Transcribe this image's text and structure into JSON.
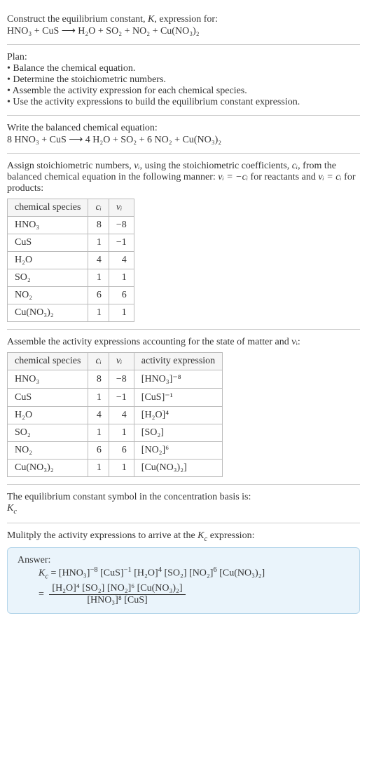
{
  "intro": {
    "line1": "Construct the equilibrium constant, ",
    "K": "K",
    "line1b": ", expression for:",
    "eq": "HNO₃ + CuS ⟶ H₂O + SO₂ + NO₂ + Cu(NO₃)₂"
  },
  "plan": {
    "header": "Plan:",
    "b1": "• Balance the chemical equation.",
    "b2": "• Determine the stoichiometric numbers.",
    "b3": "• Assemble the activity expression for each chemical species.",
    "b4": "• Use the activity expressions to build the equilibrium constant expression."
  },
  "balanced": {
    "header": "Write the balanced chemical equation:",
    "eq": "8 HNO₃ + CuS ⟶ 4 H₂O + SO₂ + 6 NO₂ + Cu(NO₃)₂"
  },
  "stoich": {
    "text1": "Assign stoichiometric numbers, ",
    "nu": "νᵢ",
    "text2": ", using the stoichiometric coefficients, ",
    "ci": "cᵢ",
    "text3": ", from the balanced chemical equation in the following manner: ",
    "rule1": "νᵢ = −cᵢ",
    "text4": " for reactants and ",
    "rule2": "νᵢ = cᵢ",
    "text5": " for products:",
    "headers": {
      "h1": "chemical species",
      "h2": "cᵢ",
      "h3": "νᵢ"
    },
    "rows": [
      {
        "sp": "HNO₃",
        "c": "8",
        "v": "−8"
      },
      {
        "sp": "CuS",
        "c": "1",
        "v": "−1"
      },
      {
        "sp": "H₂O",
        "c": "4",
        "v": "4"
      },
      {
        "sp": "SO₂",
        "c": "1",
        "v": "1"
      },
      {
        "sp": "NO₂",
        "c": "6",
        "v": "6"
      },
      {
        "sp": "Cu(NO₃)₂",
        "c": "1",
        "v": "1"
      }
    ]
  },
  "activity": {
    "text": "Assemble the activity expressions accounting for the state of matter and νᵢ:",
    "headers": {
      "h1": "chemical species",
      "h2": "cᵢ",
      "h3": "νᵢ",
      "h4": "activity expression"
    },
    "rows": [
      {
        "sp": "HNO₃",
        "c": "8",
        "v": "−8",
        "a": "[HNO₃]⁻⁸"
      },
      {
        "sp": "CuS",
        "c": "1",
        "v": "−1",
        "a": "[CuS]⁻¹"
      },
      {
        "sp": "H₂O",
        "c": "4",
        "v": "4",
        "a": "[H₂O]⁴"
      },
      {
        "sp": "SO₂",
        "c": "1",
        "v": "1",
        "a": "[SO₂]"
      },
      {
        "sp": "NO₂",
        "c": "6",
        "v": "6",
        "a": "[NO₂]⁶"
      },
      {
        "sp": "Cu(NO₃)₂",
        "c": "1",
        "v": "1",
        "a": "[Cu(NO₃)₂]"
      }
    ]
  },
  "symbol": {
    "text": "The equilibrium constant symbol in the concentration basis is:",
    "kc": "K_c"
  },
  "final": {
    "text": "Mulitply the activity expressions to arrive at the K_c expression:",
    "answer_label": "Answer:",
    "line1": "K_c = [HNO₃]⁻⁸ [CuS]⁻¹ [H₂O]⁴ [SO₂] [NO₂]⁶ [Cu(NO₃)₂]",
    "frac_num": "[H₂O]⁴ [SO₂] [NO₂]⁶ [Cu(NO₃)₂]",
    "frac_den": "[HNO₃]⁸ [CuS]",
    "eq": "= "
  },
  "chart_data": {
    "type": "table",
    "tables": [
      {
        "title": "Stoichiometric numbers",
        "columns": [
          "chemical species",
          "cᵢ",
          "νᵢ"
        ],
        "rows": [
          [
            "HNO₃",
            8,
            -8
          ],
          [
            "CuS",
            1,
            -1
          ],
          [
            "H₂O",
            4,
            4
          ],
          [
            "SO₂",
            1,
            1
          ],
          [
            "NO₂",
            6,
            6
          ],
          [
            "Cu(NO₃)₂",
            1,
            1
          ]
        ]
      },
      {
        "title": "Activity expressions",
        "columns": [
          "chemical species",
          "cᵢ",
          "νᵢ",
          "activity expression"
        ],
        "rows": [
          [
            "HNO₃",
            8,
            -8,
            "[HNO₃]⁻⁸"
          ],
          [
            "CuS",
            1,
            -1,
            "[CuS]⁻¹"
          ],
          [
            "H₂O",
            4,
            4,
            "[H₂O]⁴"
          ],
          [
            "SO₂",
            1,
            1,
            "[SO₂]"
          ],
          [
            "NO₂",
            6,
            6,
            "[NO₂]⁶"
          ],
          [
            "Cu(NO₃)₂",
            1,
            1,
            "[Cu(NO₃)₂]"
          ]
        ]
      }
    ]
  }
}
